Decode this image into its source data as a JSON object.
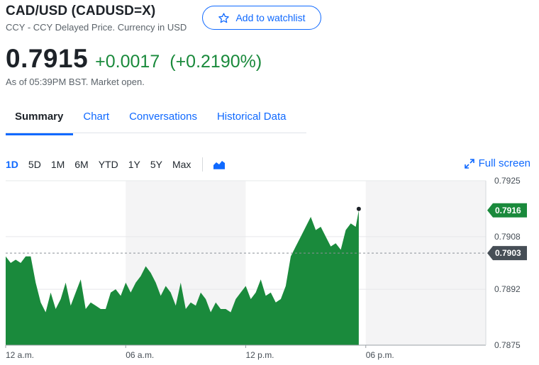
{
  "header": {
    "title": "CAD/USD (CADUSD=X)",
    "subtitle": "CCY - CCY Delayed Price. Currency in USD",
    "watchlist_label": "Add to watchlist"
  },
  "quote": {
    "price": "0.7915",
    "change": "+0.0017",
    "change_percent": "(+0.2190%)",
    "as_of": "As of 05:39PM BST. Market open."
  },
  "tabs": [
    "Summary",
    "Chart",
    "Conversations",
    "Historical Data"
  ],
  "active_tab": "Summary",
  "ranges": [
    "1D",
    "5D",
    "1M",
    "6M",
    "YTD",
    "1Y",
    "5Y",
    "Max"
  ],
  "active_range": "1D",
  "chart_type_icon": "area-chart-icon",
  "full_screen_label": "Full screen",
  "colors": {
    "accent": "#0f69ff",
    "positive": "#1a8a3c",
    "area": "#1a8a3c",
    "prev_close": "#464e56"
  },
  "chart_data": {
    "type": "area",
    "x_ticks": [
      "12 a.m.",
      "06 a.m.",
      "12 p.m.",
      "06 p.m."
    ],
    "y_ticks": [
      "0.7925",
      "0.7908",
      "0.7892",
      "0.7875"
    ],
    "ylim": [
      0.7875,
      0.7925
    ],
    "xlim_hours": [
      0,
      24
    ],
    "current_price_label": "0.7916",
    "previous_close_label": "0.7903",
    "previous_close": 0.7903,
    "current_price": 0.7916,
    "grid": true,
    "shaded_bands_hours": [
      [
        6,
        12
      ],
      [
        18,
        24
      ]
    ],
    "series": [
      {
        "x": [
          0,
          0.25,
          0.5,
          0.75,
          1.0,
          1.25,
          1.5,
          1.75,
          2.0,
          2.25,
          2.5,
          2.75,
          3.0,
          3.25,
          3.5,
          3.75,
          4.0,
          4.25,
          4.5,
          4.75,
          5.0,
          5.25,
          5.5,
          5.75,
          6.0,
          6.25,
          6.5,
          6.75,
          7.0,
          7.25,
          7.5,
          7.75,
          8.0,
          8.25,
          8.5,
          8.75,
          9.0,
          9.25,
          9.5,
          9.75,
          10.0,
          10.25,
          10.5,
          10.75,
          11.0,
          11.25,
          11.5,
          11.75,
          12.0,
          12.25,
          12.5,
          12.75,
          13.0,
          13.25,
          13.5,
          13.75,
          14.0,
          14.25,
          14.5,
          14.75,
          15.0,
          15.25,
          15.5,
          15.75,
          16.0,
          16.25,
          16.5,
          16.75,
          17.0,
          17.25,
          17.5,
          17.65
        ],
        "values": [
          0.7902,
          0.79,
          0.7901,
          0.79,
          0.7902,
          0.7902,
          0.7894,
          0.7888,
          0.7885,
          0.7891,
          0.7886,
          0.7889,
          0.7894,
          0.7887,
          0.7891,
          0.7895,
          0.7886,
          0.7888,
          0.7887,
          0.7886,
          0.7886,
          0.7891,
          0.7892,
          0.789,
          0.7894,
          0.7891,
          0.7894,
          0.7896,
          0.7899,
          0.7897,
          0.7894,
          0.789,
          0.7893,
          0.7891,
          0.7887,
          0.7894,
          0.7886,
          0.7888,
          0.7887,
          0.7891,
          0.7889,
          0.7885,
          0.7888,
          0.7886,
          0.7886,
          0.7885,
          0.7889,
          0.7891,
          0.7893,
          0.7889,
          0.7891,
          0.7895,
          0.789,
          0.7891,
          0.7888,
          0.7889,
          0.7893,
          0.7902,
          0.7905,
          0.7908,
          0.7911,
          0.7914,
          0.791,
          0.7911,
          0.7908,
          0.7905,
          0.7906,
          0.7904,
          0.791,
          0.7912,
          0.7911,
          0.7916
        ]
      }
    ]
  }
}
